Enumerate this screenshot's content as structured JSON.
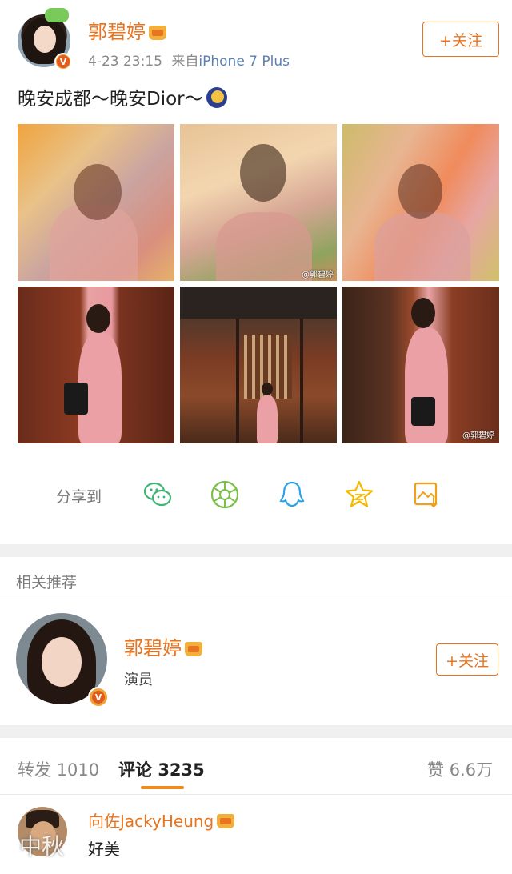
{
  "post": {
    "username": "郭碧婷",
    "date": "4-23 23:15",
    "source_prefix": "来自",
    "source": "iPhone 7 Plus",
    "follow_label": "+关注",
    "text": "晚安成都～晚安Dior～",
    "emoji_icon": "moon-emoji-icon",
    "badge_letter": "V",
    "photo_watermarks": [
      "@郭碧婷",
      "@郭碧婷"
    ]
  },
  "share": {
    "label": "分享到",
    "targets": [
      {
        "name": "wechat",
        "icon": "wechat-icon",
        "color": "#3eb575"
      },
      {
        "name": "moments",
        "icon": "wechat-moments-icon",
        "color": "#7bc046"
      },
      {
        "name": "qq",
        "icon": "qq-icon",
        "color": "#2fa1e6"
      },
      {
        "name": "qzone",
        "icon": "qzone-star-icon",
        "color": "#f5b800"
      },
      {
        "name": "save-image",
        "icon": "save-image-icon",
        "color": "#f0a01b"
      }
    ]
  },
  "recommend": {
    "title": "相关推荐",
    "name": "郭碧婷",
    "desc": "演员",
    "follow_label": "+关注"
  },
  "tabs": {
    "repost_label": "转发",
    "repost_count": "1010",
    "comment_label": "评论",
    "comment_count": "3235",
    "like_label": "赞",
    "like_count": "6.6万"
  },
  "comment": {
    "name": "向佐JackyHeung",
    "text": "好美",
    "overlay": "中秋"
  },
  "colors": {
    "accent_orange": "#e8741f",
    "link_blue": "#5a7fb5",
    "tab_underline": "#f28a1c"
  }
}
